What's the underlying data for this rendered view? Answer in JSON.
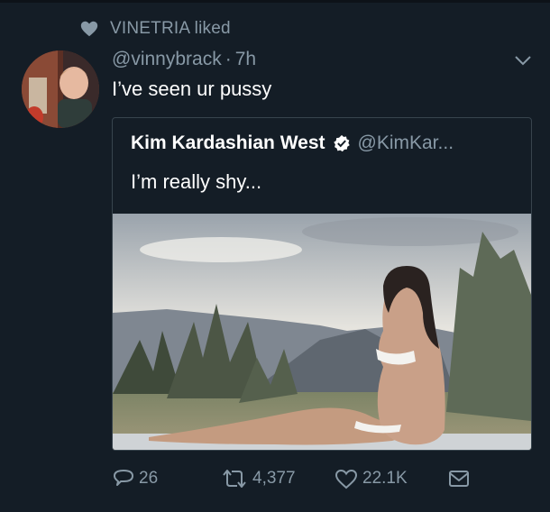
{
  "context": {
    "liked_text": "VINETRIA liked"
  },
  "tweet": {
    "handle": "@vinnybrack",
    "separator": "·",
    "time": "7h",
    "text": "I’ve seen ur pussy"
  },
  "quote": {
    "name": "Kim Kardashian West",
    "handle": "@KimKar...",
    "text": "I’m really shy..."
  },
  "actions": {
    "replies": "26",
    "retweets": "4,377",
    "likes": "22.1K"
  },
  "icons": [
    "heart-icon",
    "chevron-down-icon",
    "verified-badge-icon",
    "reply-icon",
    "retweet-icon",
    "like-icon",
    "message-icon"
  ],
  "colors": {
    "background": "#141d26",
    "secondary_text": "#8899a6",
    "border": "#38444d"
  }
}
